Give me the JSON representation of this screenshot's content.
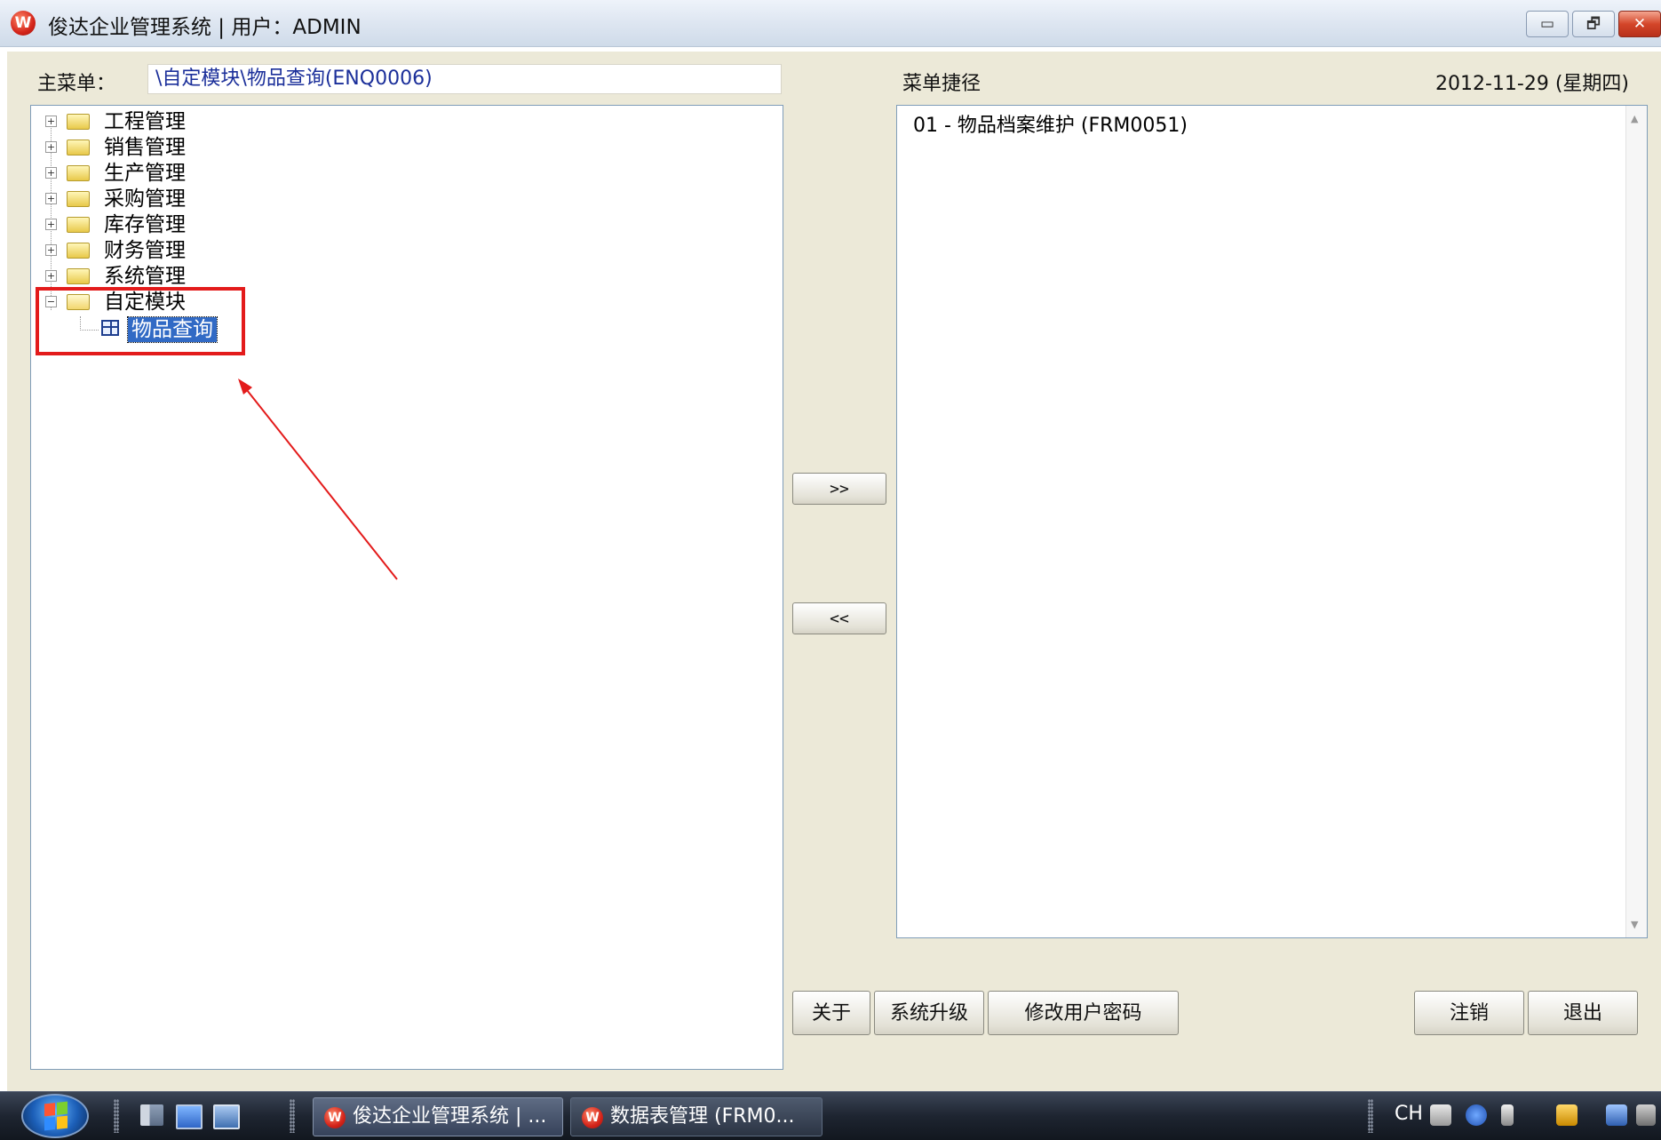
{
  "window": {
    "title": "俊达企业管理系统 | 用户：ADMIN",
    "app_icon_glyph": "W",
    "controls": {
      "minimize": "▭",
      "restore": "🗗",
      "close": "✕"
    }
  },
  "header": {
    "main_menu_label": "主菜单：",
    "main_menu_path": "\\自定模块\\物品查询(ENQ0006)",
    "shortcut_label": "菜单捷径",
    "date": "2012-11-29 (星期四)"
  },
  "tree": {
    "items": [
      {
        "label": "工程管理",
        "expanded": false
      },
      {
        "label": "销售管理",
        "expanded": false
      },
      {
        "label": "生产管理",
        "expanded": false
      },
      {
        "label": "采购管理",
        "expanded": false
      },
      {
        "label": "库存管理",
        "expanded": false
      },
      {
        "label": "财务管理",
        "expanded": false
      },
      {
        "label": "系统管理",
        "expanded": false
      },
      {
        "label": "自定模块",
        "expanded": true
      }
    ],
    "expand_glyph": "+",
    "collapse_glyph": "−",
    "child": {
      "label": "物品查询",
      "selected": true
    }
  },
  "transfer": {
    "add_label": ">>",
    "remove_label": "<<"
  },
  "shortcuts": {
    "items": [
      "01 - 物品档案维护 (FRM0051)"
    ]
  },
  "buttons": {
    "about": "关于",
    "upgrade": "系统升级",
    "change_password": "修改用户密码",
    "logout": "注销",
    "exit": "退出"
  },
  "taskbar": {
    "tasks": [
      {
        "label": "俊达企业管理系统 | ...",
        "active": true
      },
      {
        "label": "数据表管理 (FRM0...",
        "active": false
      }
    ],
    "tray": {
      "language": "CH"
    }
  },
  "colors": {
    "annotation": "#e31b1b",
    "selection": "#316ac5",
    "path_text": "#1b2f9a",
    "client_bg": "#ece9d8"
  }
}
